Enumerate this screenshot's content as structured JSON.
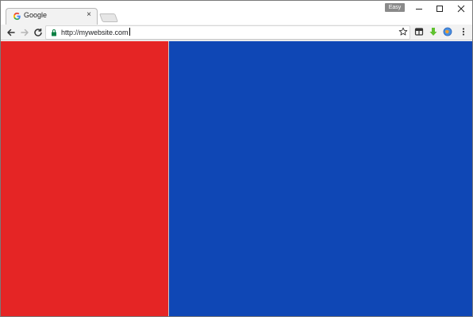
{
  "tab": {
    "title": "Google",
    "close_glyph": "×"
  },
  "window": {
    "profile_label": "Easy",
    "icons": {
      "minimize": "minimize-icon",
      "maximize": "maximize-icon",
      "close": "close-icon"
    }
  },
  "toolbar": {
    "url": "http://mywebsite.com",
    "icons": {
      "back": "arrow-left-icon",
      "forward": "arrow-right-icon",
      "reload": "reload-icon",
      "secure": "lock-icon",
      "bookmark": "star-icon",
      "ext1": "extension-icon",
      "ext2": "download-arrow-icon",
      "ext3": "globe-icon",
      "menu": "kebab-menu-icon"
    }
  },
  "colors": {
    "left_panel": "#e52525",
    "right_panel": "#0f47b5",
    "toolbar_bg": "#f2f2f2",
    "tab_bg": "#f2f2f2"
  }
}
